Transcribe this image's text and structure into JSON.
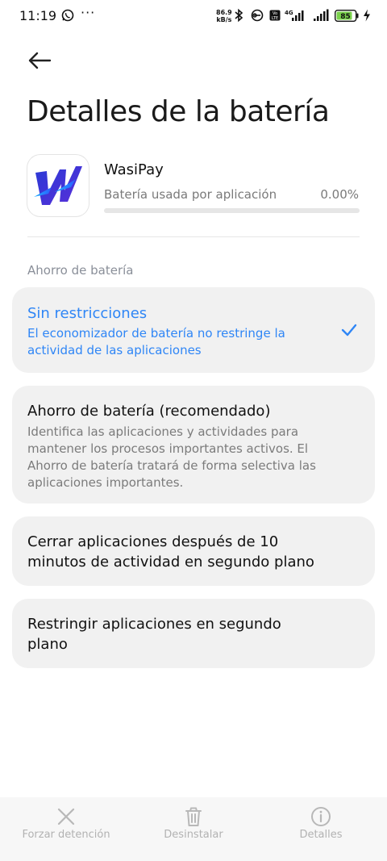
{
  "status_bar": {
    "time": "11:19",
    "more": "···",
    "net_speed_value": "86.9",
    "net_speed_unit": "kB/s",
    "battery_level": "85",
    "icons": [
      "whatsapp-icon",
      "bluetooth-icon",
      "hd-icon",
      "volte-icon",
      "signal-4g-icon",
      "signal-icon",
      "battery-icon",
      "charging-icon"
    ]
  },
  "page": {
    "title": "Detalles de la batería"
  },
  "app": {
    "name": "WasiPay",
    "usage_label": "Batería usada por aplicación",
    "usage_value": "0.00%",
    "usage_fraction": 0.0
  },
  "section": {
    "label": "Ahorro de batería"
  },
  "options": [
    {
      "title": "Sin restricciones",
      "description": "El economizador de batería no restringe la actividad de las aplicaciones",
      "selected": true
    },
    {
      "title": "Ahorro de batería (recomendado)",
      "description": "Identifica las aplicaciones y actividades para mantener los procesos importantes activos. El Ahorro de batería tratará de forma selectiva las aplicaciones importantes.",
      "selected": false
    },
    {
      "title": "Cerrar aplicaciones después de 10 minutos de actividad en segundo plano",
      "selected": false
    },
    {
      "title": "Restringir aplicaciones en segundo plano",
      "selected": false
    }
  ],
  "bottom_bar": {
    "force_stop": "Forzar detención",
    "uninstall": "Desinstalar",
    "details": "Detalles"
  },
  "colors": {
    "accent": "#2f86f6",
    "card_bg": "#f1f1f1",
    "battery_fill": "#7ad14b"
  }
}
